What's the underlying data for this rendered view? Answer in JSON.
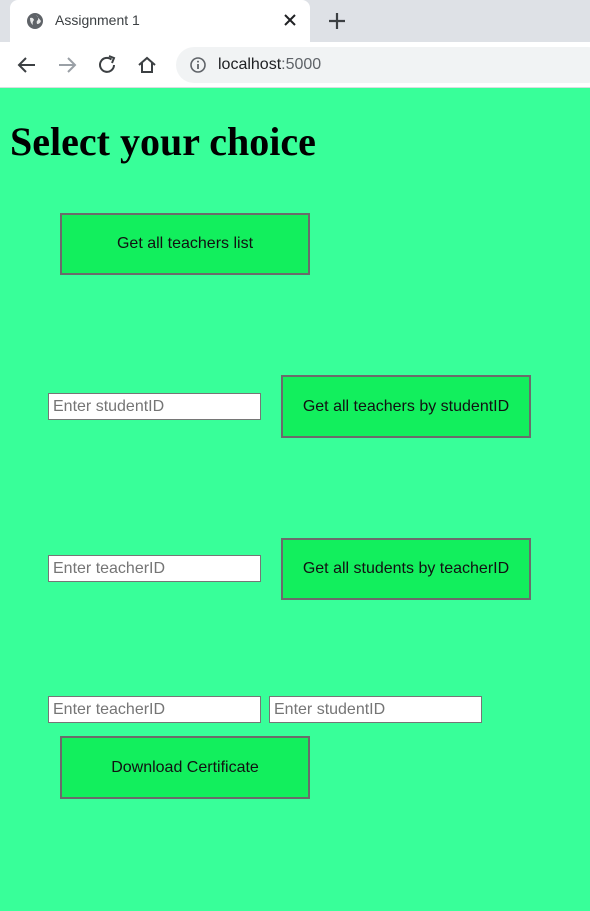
{
  "browser": {
    "tab_title": "Assignment 1",
    "url_host": "localhost",
    "url_port": ":5000"
  },
  "page": {
    "heading": "Select your choice",
    "get_all_teachers_label": "Get all teachers list",
    "student_id_placeholder": "Enter studentID",
    "teachers_by_student_label": "Get all teachers by studentID",
    "teacher_id_placeholder": "Enter teacherID",
    "students_by_teacher_label": "Get all students by teacherID",
    "cert_teacher_placeholder": "Enter teacherID",
    "cert_student_placeholder": "Enter studentID",
    "download_certificate_label": "Download Certificate"
  },
  "colors": {
    "page_background": "#38ff99",
    "button_background": "#12ef5d"
  }
}
